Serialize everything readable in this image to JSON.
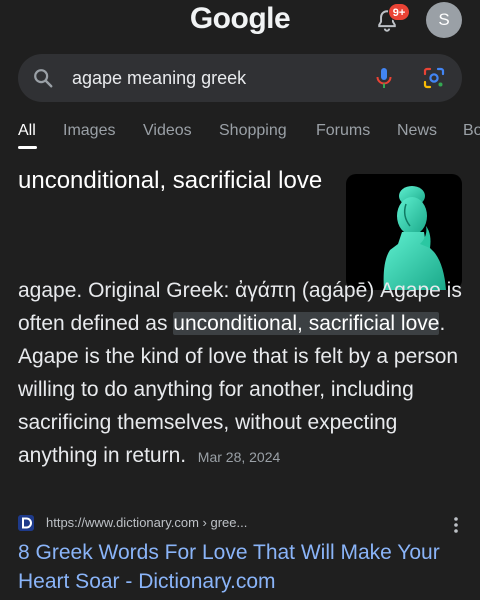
{
  "header": {
    "logo": "Google",
    "notification_badge": "9+",
    "avatar_initial": "S"
  },
  "search": {
    "query": "agape meaning greek"
  },
  "tabs": [
    {
      "label": "All",
      "active": true
    },
    {
      "label": "Images",
      "active": false
    },
    {
      "label": "Videos",
      "active": false
    },
    {
      "label": "Shopping",
      "active": false
    },
    {
      "label": "Forums",
      "active": false
    },
    {
      "label": "News",
      "active": false
    },
    {
      "label": "Bo",
      "active": false
    }
  ],
  "featured": {
    "title": "unconditional, sacrificial love",
    "snippet_before": "agape. Original Greek: ἀγάπη (agápē) Agape is often defined as ",
    "snippet_highlight": "unconditional, sacrificial love",
    "snippet_after": ". Agape is the kind of love that is felt by a person willing to do anything for another, including sacrificing themselves, without expecting anything in return.",
    "date": "Mar 28, 2024",
    "thumbnail_icon": "statue-image"
  },
  "result": {
    "url": "https://www.dictionary.com › gree...",
    "title": "8 Greek Words For Love That Will Make Your Heart Soar - Dictionary.com",
    "favicon": "dictionary-favicon-icon"
  },
  "colors": {
    "background": "#1f1f1f",
    "search_bg": "#303134",
    "link": "#8ab4f8",
    "badge": "#ea4335"
  }
}
